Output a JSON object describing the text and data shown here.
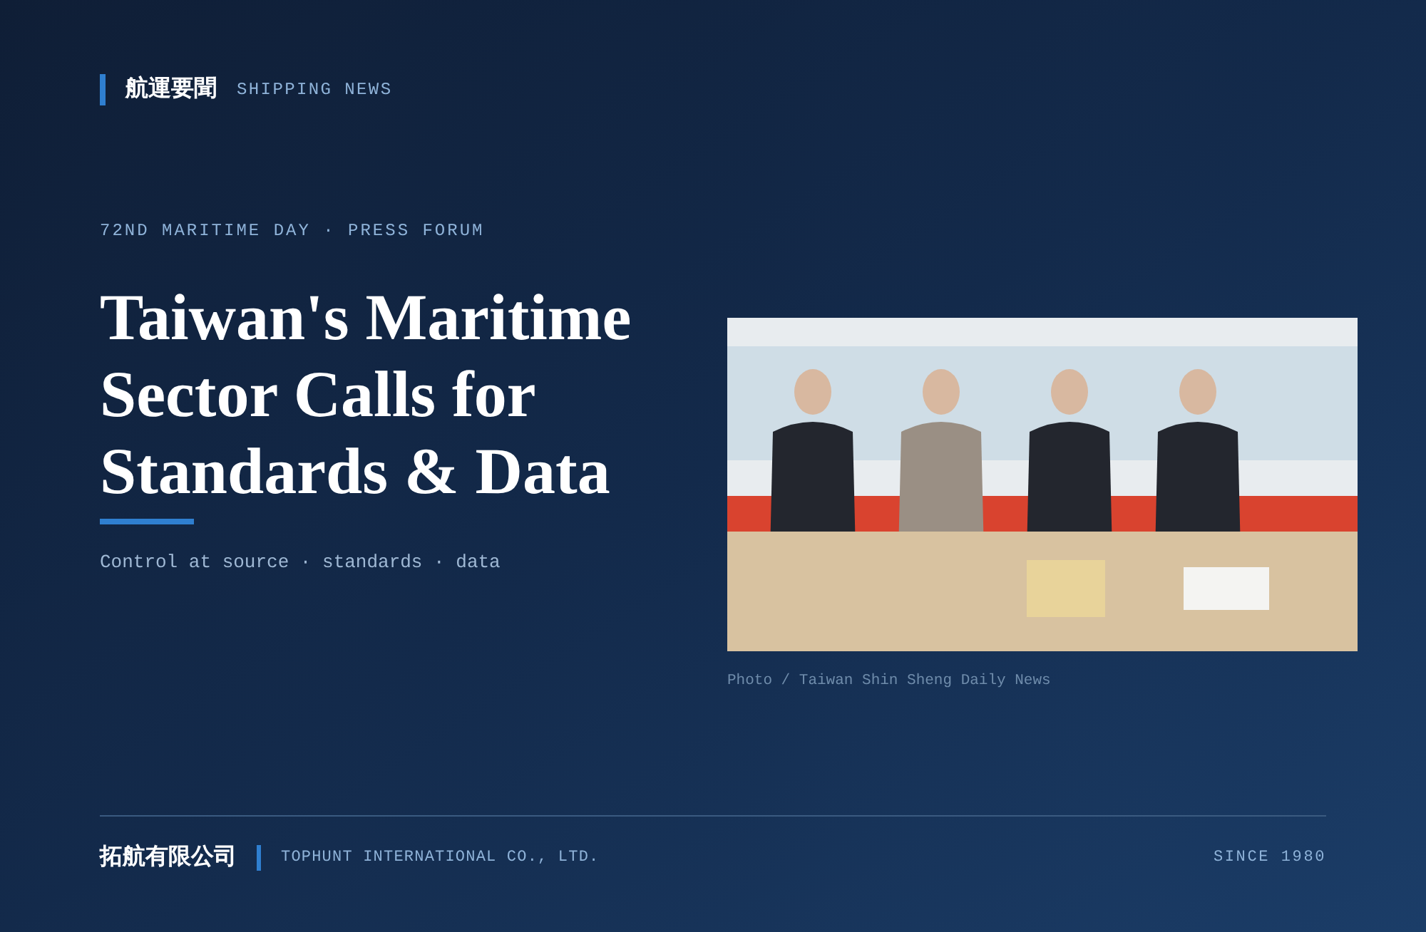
{
  "header": {
    "label_zh": "航運要聞",
    "label_en": "SHIPPING NEWS"
  },
  "eyebrow": "72ND MARITIME DAY · PRESS FORUM",
  "headline": "Taiwan's Maritime Sector Calls for Standards & Data",
  "subtitle": "Control at source · standards · data",
  "photo": {
    "kind": "picture",
    "caption": "Photo / Taiwan Shin Sheng Daily News"
  },
  "footer": {
    "company_zh": "拓航有限公司",
    "company_en": "TOPHUNT INTERNATIONAL CO., LTD.",
    "since": "SINCE 1980"
  }
}
